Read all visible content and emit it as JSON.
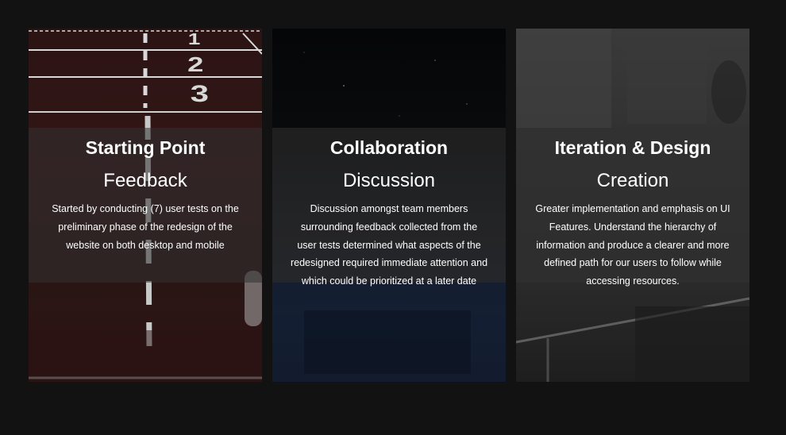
{
  "cards": [
    {
      "title": "Starting Point",
      "subtitle": "Feedback",
      "text": "Started by conducting (7) user tests on the preliminary phase of the redesign of the website on both desktop and mobile",
      "lane_numbers": [
        "1",
        "2",
        "3"
      ]
    },
    {
      "title": "Collaboration",
      "subtitle": "Discussion",
      "text": "Discussion amongst team members surrounding feedback collected from the user tests determined what aspects of the redesigned required immediate attention and which could be prioritized at a later date"
    },
    {
      "title": "Iteration & Design",
      "subtitle": "Creation",
      "text": "Greater implementation and emphasis on UI Features. Understand the hierarchy of information and produce a clearer and more defined path for our users to follow while accessing resources."
    }
  ],
  "colors": {
    "page_background": "#121212",
    "text": "#ffffff",
    "overlay": "rgba(50,50,50,0.55)"
  }
}
